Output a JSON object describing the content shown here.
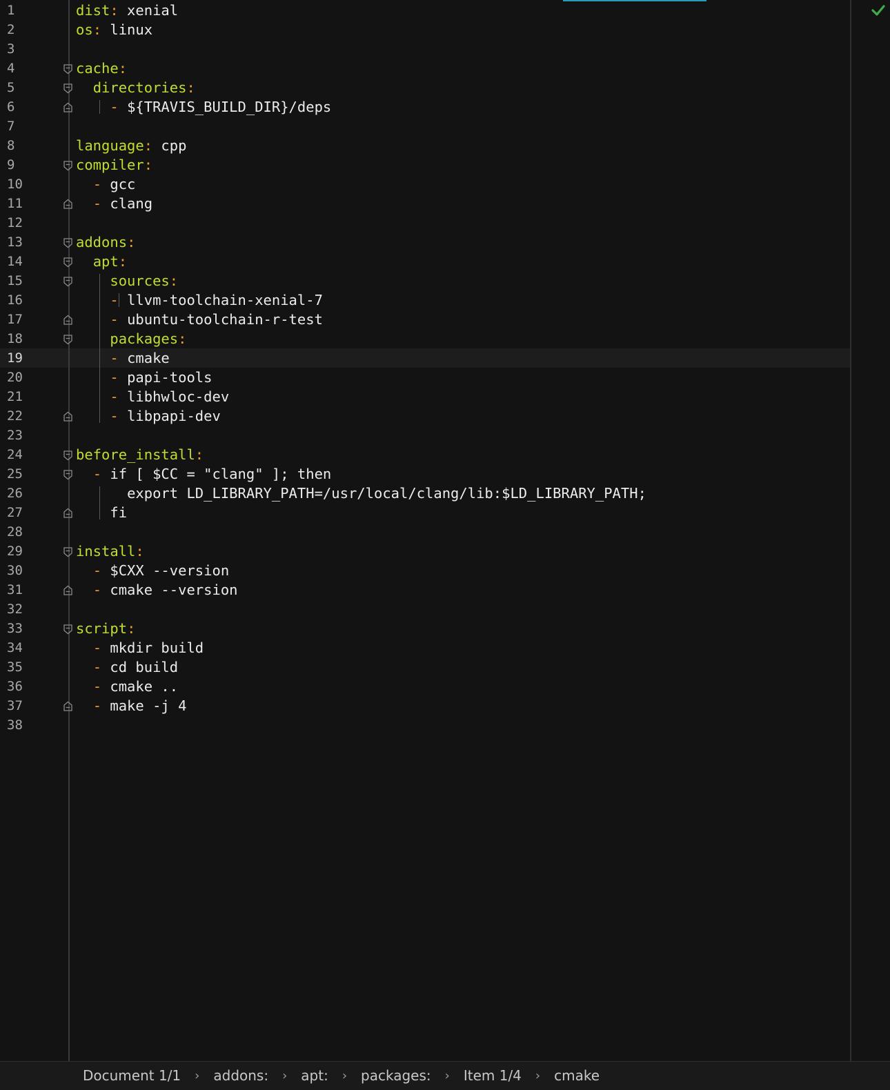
{
  "editor": {
    "current_line": 19,
    "status_ok": true,
    "lines": [
      {
        "n": "1",
        "indent": "",
        "dash": "",
        "key": "dist",
        "colon": ":",
        "val": " xenial"
      },
      {
        "n": "2",
        "indent": "",
        "dash": "",
        "key": "os",
        "colon": ":",
        "val": " linux"
      },
      {
        "n": "3",
        "indent": "",
        "dash": "",
        "key": "",
        "colon": "",
        "val": ""
      },
      {
        "n": "4",
        "indent": "",
        "dash": "",
        "key": "cache",
        "colon": ":",
        "val": ""
      },
      {
        "n": "5",
        "indent": "  ",
        "dash": "",
        "key": "directories",
        "colon": ":",
        "val": ""
      },
      {
        "n": "6",
        "indent": "  ",
        "dash": "  - ",
        "key": "",
        "colon": "",
        "val": "${TRAVIS_BUILD_DIR}/deps"
      },
      {
        "n": "7",
        "indent": "",
        "dash": "",
        "key": "",
        "colon": "",
        "val": ""
      },
      {
        "n": "8",
        "indent": "",
        "dash": "",
        "key": "language",
        "colon": ":",
        "val": " cpp"
      },
      {
        "n": "9",
        "indent": "",
        "dash": "",
        "key": "compiler",
        "colon": ":",
        "val": ""
      },
      {
        "n": "10",
        "indent": "  ",
        "dash": "- ",
        "key": "",
        "colon": "",
        "val": "gcc"
      },
      {
        "n": "11",
        "indent": "  ",
        "dash": "- ",
        "key": "",
        "colon": "",
        "val": "clang"
      },
      {
        "n": "12",
        "indent": "",
        "dash": "",
        "key": "",
        "colon": "",
        "val": ""
      },
      {
        "n": "13",
        "indent": "",
        "dash": "",
        "key": "addons",
        "colon": ":",
        "val": ""
      },
      {
        "n": "14",
        "indent": "  ",
        "dash": "",
        "key": "apt",
        "colon": ":",
        "val": ""
      },
      {
        "n": "15",
        "indent": "    ",
        "dash": "",
        "key": "sources",
        "colon": ":",
        "val": ""
      },
      {
        "n": "16",
        "indent": "    ",
        "dash": "- ",
        "key": "",
        "colon": "",
        "val": "llvm-toolchain-xenial-7"
      },
      {
        "n": "17",
        "indent": "    ",
        "dash": "- ",
        "key": "",
        "colon": "",
        "val": "ubuntu-toolchain-r-test"
      },
      {
        "n": "18",
        "indent": "    ",
        "dash": "",
        "key": "packages",
        "colon": ":",
        "val": ""
      },
      {
        "n": "19",
        "indent": "    ",
        "dash": "- ",
        "key": "",
        "colon": "",
        "val": "cmake"
      },
      {
        "n": "20",
        "indent": "    ",
        "dash": "- ",
        "key": "",
        "colon": "",
        "val": "papi-tools"
      },
      {
        "n": "21",
        "indent": "    ",
        "dash": "- ",
        "key": "",
        "colon": "",
        "val": "libhwloc-dev"
      },
      {
        "n": "22",
        "indent": "    ",
        "dash": "- ",
        "key": "",
        "colon": "",
        "val": "libpapi-dev"
      },
      {
        "n": "23",
        "indent": "",
        "dash": "",
        "key": "",
        "colon": "",
        "val": ""
      },
      {
        "n": "24",
        "indent": "",
        "dash": "",
        "key": "before_install",
        "colon": ":",
        "val": ""
      },
      {
        "n": "25",
        "indent": "  ",
        "dash": "- ",
        "key": "",
        "colon": "",
        "val": "if [ $CC = \"clang\" ]; then"
      },
      {
        "n": "26",
        "indent": "      ",
        "dash": "",
        "key": "",
        "colon": "",
        "val": "export LD_LIBRARY_PATH=/usr/local/clang/lib:$LD_LIBRARY_PATH;"
      },
      {
        "n": "27",
        "indent": "    ",
        "dash": "",
        "key": "",
        "colon": "",
        "val": "fi"
      },
      {
        "n": "28",
        "indent": "",
        "dash": "",
        "key": "",
        "colon": "",
        "val": ""
      },
      {
        "n": "29",
        "indent": "",
        "dash": "",
        "key": "install",
        "colon": ":",
        "val": ""
      },
      {
        "n": "30",
        "indent": "  ",
        "dash": "- ",
        "key": "",
        "colon": "",
        "val": "$CXX --version"
      },
      {
        "n": "31",
        "indent": "  ",
        "dash": "- ",
        "key": "",
        "colon": "",
        "val": "cmake --version"
      },
      {
        "n": "32",
        "indent": "",
        "dash": "",
        "key": "",
        "colon": "",
        "val": ""
      },
      {
        "n": "33",
        "indent": "",
        "dash": "",
        "key": "script",
        "colon": ":",
        "val": ""
      },
      {
        "n": "34",
        "indent": "  ",
        "dash": "- ",
        "key": "",
        "colon": "",
        "val": "mkdir build"
      },
      {
        "n": "35",
        "indent": "  ",
        "dash": "- ",
        "key": "",
        "colon": "",
        "val": "cd build"
      },
      {
        "n": "36",
        "indent": "  ",
        "dash": "- ",
        "key": "",
        "colon": "",
        "val": "cmake .."
      },
      {
        "n": "37",
        "indent": "  ",
        "dash": "- ",
        "key": "",
        "colon": "",
        "val": "make -j 4"
      },
      {
        "n": "38",
        "indent": "",
        "dash": "",
        "key": "",
        "colon": "",
        "val": ""
      }
    ],
    "folds": {
      "4": "open",
      "5": "open",
      "6": "close",
      "9": "open",
      "11": "close",
      "13": "open",
      "14": "open",
      "15": "open",
      "17": "close",
      "18": "open",
      "22": "close",
      "24": "open",
      "25": "open",
      "27": "close",
      "29": "open",
      "31": "close",
      "33": "open",
      "37": "close"
    }
  },
  "statusbar": {
    "breadcrumbs": [
      "Document 1/1",
      "addons:",
      "apt:",
      "packages:",
      "Item 1/4",
      "cmake"
    ],
    "separator": "›"
  },
  "colors": {
    "key": "#c4dc30",
    "punct": "#f0a02a",
    "text": "#e8e8e8",
    "background": "#131313",
    "check": "#3fae49",
    "accent": "#2a9bb5"
  }
}
